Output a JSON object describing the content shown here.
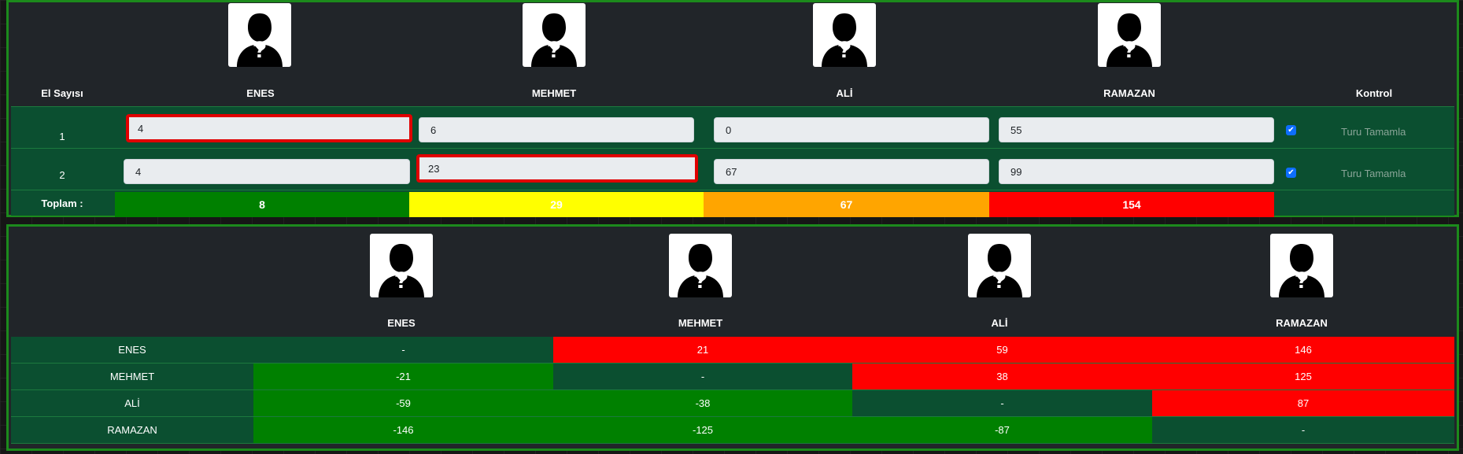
{
  "colors": {
    "panel_bg": "#212529",
    "panel_border": "#1c8a1c",
    "row_bg": "#0b4f30",
    "green": "#008000",
    "yellow": "#ffff00",
    "orange": "#ffa500",
    "red": "#ff0000"
  },
  "score_table": {
    "round_header": "El Sayısı",
    "control_header": "Kontrol",
    "players": [
      {
        "name": "ENES",
        "avatar_icon": "unknown-person-icon"
      },
      {
        "name": "MEHMET",
        "avatar_icon": "unknown-person-icon"
      },
      {
        "name": "ALİ",
        "avatar_icon": "unknown-person-icon"
      },
      {
        "name": "RAMAZAN",
        "avatar_icon": "unknown-person-icon"
      }
    ],
    "rounds": [
      {
        "number": "1",
        "scores": [
          "4",
          "6",
          "0",
          "55"
        ],
        "checked": true,
        "complete_label": "Turu Tamamla"
      },
      {
        "number": "2",
        "scores": [
          "4",
          "23",
          "67",
          "99"
        ],
        "checked": true,
        "complete_label": "Turu Tamamla"
      }
    ],
    "total_label": "Toplam :",
    "totals": [
      "8",
      "29",
      "67",
      "154"
    ],
    "total_colors": [
      "green",
      "yellow",
      "orange",
      "red"
    ]
  },
  "diff_matrix": {
    "players": [
      {
        "name": "ENES",
        "avatar_icon": "unknown-person-icon"
      },
      {
        "name": "MEHMET",
        "avatar_icon": "unknown-person-icon"
      },
      {
        "name": "ALİ",
        "avatar_icon": "unknown-person-icon"
      },
      {
        "name": "RAMAZAN",
        "avatar_icon": "unknown-person-icon"
      }
    ],
    "rows": [
      {
        "name": "ENES",
        "cells": [
          "-",
          "21",
          "59",
          "146"
        ]
      },
      {
        "name": "MEHMET",
        "cells": [
          "-21",
          "-",
          "38",
          "125"
        ]
      },
      {
        "name": "ALİ",
        "cells": [
          "-59",
          "-38",
          "-",
          "87"
        ]
      },
      {
        "name": "RAMAZAN",
        "cells": [
          "-146",
          "-125",
          "-87",
          "-"
        ]
      }
    ]
  }
}
